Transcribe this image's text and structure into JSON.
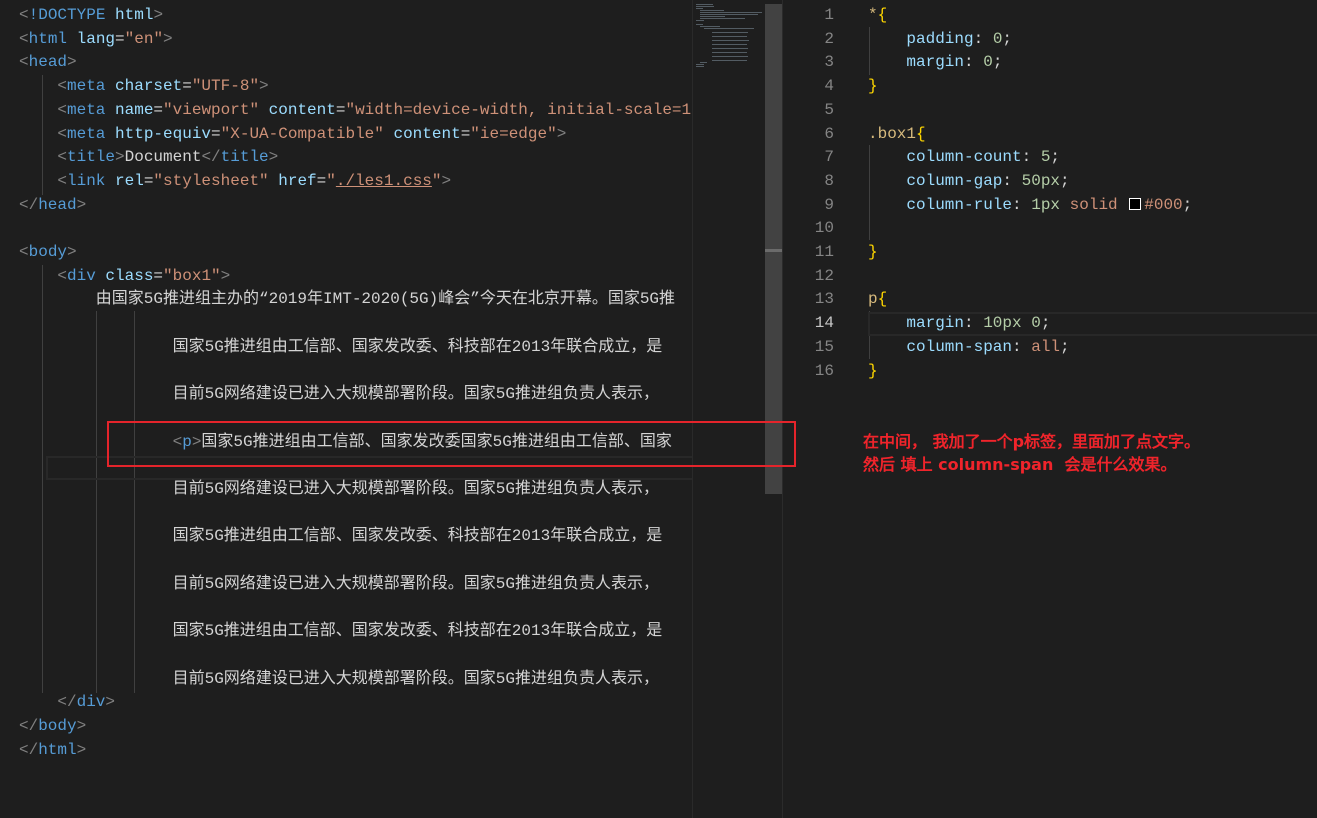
{
  "html_editor": {
    "lines": [
      {
        "indent": 0,
        "tokens": [
          [
            "<",
            "p"
          ],
          [
            "!DOCTYPE",
            "tag"
          ],
          [
            " html",
            "attr"
          ],
          [
            ">",
            "p"
          ]
        ]
      },
      {
        "indent": 0,
        "tokens": [
          [
            "<",
            "p"
          ],
          [
            "html",
            "tag"
          ],
          [
            " lang",
            "attr"
          ],
          [
            "=",
            "txt"
          ],
          [
            "\"en\"",
            "str"
          ],
          [
            ">",
            "p"
          ]
        ]
      },
      {
        "indent": 0,
        "tokens": [
          [
            "<",
            "p"
          ],
          [
            "head",
            "tag"
          ],
          [
            ">",
            "p"
          ]
        ]
      },
      {
        "indent": 4,
        "tokens": [
          [
            "<",
            "p"
          ],
          [
            "meta",
            "tag"
          ],
          [
            " charset",
            "attr"
          ],
          [
            "=",
            "txt"
          ],
          [
            "\"UTF-8\"",
            "str"
          ],
          [
            ">",
            "p"
          ]
        ]
      },
      {
        "indent": 4,
        "tokens": [
          [
            "<",
            "p"
          ],
          [
            "meta",
            "tag"
          ],
          [
            " name",
            "attr"
          ],
          [
            "=",
            "txt"
          ],
          [
            "\"viewport\"",
            "str"
          ],
          [
            " content",
            "attr"
          ],
          [
            "=",
            "txt"
          ],
          [
            "\"width=device-width, initial-scale=1",
            "str"
          ]
        ]
      },
      {
        "indent": 4,
        "tokens": [
          [
            "<",
            "p"
          ],
          [
            "meta",
            "tag"
          ],
          [
            " http-equiv",
            "attr"
          ],
          [
            "=",
            "txt"
          ],
          [
            "\"X-UA-Compatible\"",
            "str"
          ],
          [
            " content",
            "attr"
          ],
          [
            "=",
            "txt"
          ],
          [
            "\"ie=edge\"",
            "str"
          ],
          [
            ">",
            "p"
          ]
        ]
      },
      {
        "indent": 4,
        "tokens": [
          [
            "<",
            "p"
          ],
          [
            "title",
            "tag"
          ],
          [
            ">",
            "p"
          ],
          [
            "Document",
            "txt"
          ],
          [
            "</",
            "p"
          ],
          [
            "title",
            "tag"
          ],
          [
            ">",
            "p"
          ]
        ]
      },
      {
        "indent": 4,
        "tokens": [
          [
            "<",
            "p"
          ],
          [
            "link",
            "tag"
          ],
          [
            " rel",
            "attr"
          ],
          [
            "=",
            "txt"
          ],
          [
            "\"stylesheet\"",
            "str"
          ],
          [
            " href",
            "attr"
          ],
          [
            "=",
            "txt"
          ],
          [
            "\"",
            "str"
          ],
          [
            "./les1.css",
            "link"
          ],
          [
            "\"",
            "str"
          ],
          [
            ">",
            "p"
          ]
        ]
      },
      {
        "indent": 0,
        "tokens": [
          [
            "</",
            "p"
          ],
          [
            "head",
            "tag"
          ],
          [
            ">",
            "p"
          ]
        ]
      },
      {
        "indent": 0,
        "tokens": []
      },
      {
        "indent": 0,
        "tokens": [
          [
            "<",
            "p"
          ],
          [
            "body",
            "tag"
          ],
          [
            ">",
            "p"
          ]
        ]
      },
      {
        "indent": 4,
        "tokens": [
          [
            "<",
            "p"
          ],
          [
            "div",
            "tag"
          ],
          [
            " class",
            "attr"
          ],
          [
            "=",
            "txt"
          ],
          [
            "\"box1\"",
            "str"
          ],
          [
            ">",
            "p"
          ]
        ]
      },
      {
        "indent": 8,
        "tokens": [
          [
            "由国家5G推进组主办的“2019年IMT-2020(5G)峰会”今天在北京开幕。国家5G推",
            "txt"
          ]
        ]
      },
      {
        "indent": 0,
        "tokens": []
      },
      {
        "indent": 16,
        "tokens": [
          [
            "国家5G推进组由工信部、国家发改委、科技部在2013年联合成立，是",
            "txt"
          ]
        ]
      },
      {
        "indent": 0,
        "tokens": []
      },
      {
        "indent": 16,
        "tokens": [
          [
            "目前5G网络建设已进入大规模部署阶段。国家5G推进组负责人表示，",
            "txt"
          ]
        ]
      },
      {
        "indent": 0,
        "tokens": []
      },
      {
        "indent": 16,
        "tokens": [
          [
            "<",
            "p"
          ],
          [
            "p",
            "tag"
          ],
          [
            ">",
            "p"
          ],
          [
            "国家5G推进组由工信部、国家发改委国家5G推进组由工信部、国家",
            "txt"
          ]
        ]
      },
      {
        "indent": 0,
        "tokens": []
      },
      {
        "indent": 16,
        "tokens": [
          [
            "目前5G网络建设已进入大规模部署阶段。国家5G推进组负责人表示，",
            "txt"
          ]
        ]
      },
      {
        "indent": 0,
        "tokens": []
      },
      {
        "indent": 16,
        "tokens": [
          [
            "国家5G推进组由工信部、国家发改委、科技部在2013年联合成立，是",
            "txt"
          ]
        ]
      },
      {
        "indent": 0,
        "tokens": []
      },
      {
        "indent": 16,
        "tokens": [
          [
            "目前5G网络建设已进入大规模部署阶段。国家5G推进组负责人表示，",
            "txt"
          ]
        ]
      },
      {
        "indent": 0,
        "tokens": []
      },
      {
        "indent": 16,
        "tokens": [
          [
            "国家5G推进组由工信部、国家发改委、科技部在2013年联合成立，是",
            "txt"
          ]
        ]
      },
      {
        "indent": 0,
        "tokens": []
      },
      {
        "indent": 16,
        "tokens": [
          [
            "目前5G网络建设已进入大规模部署阶段。国家5G推进组负责人表示，",
            "txt"
          ]
        ]
      },
      {
        "indent": 4,
        "tokens": [
          [
            "</",
            "p"
          ],
          [
            "div",
            "tag"
          ],
          [
            ">",
            "p"
          ]
        ]
      },
      {
        "indent": 0,
        "tokens": [
          [
            "</",
            "p"
          ],
          [
            "body",
            "tag"
          ],
          [
            ">",
            "p"
          ]
        ]
      },
      {
        "indent": 0,
        "tokens": [
          [
            "</",
            "p"
          ],
          [
            "html",
            "tag"
          ],
          [
            ">",
            "p"
          ]
        ]
      }
    ]
  },
  "css_editor": {
    "current_line": 14,
    "lines": [
      {
        "num": "1",
        "indent": 0,
        "tokens": [
          [
            "*",
            "sel"
          ],
          [
            "{",
            "br"
          ]
        ]
      },
      {
        "num": "2",
        "indent": 4,
        "tokens": [
          [
            "padding",
            "prop"
          ],
          [
            ": ",
            "txt"
          ],
          [
            "0",
            "num"
          ],
          [
            ";",
            "txt"
          ]
        ]
      },
      {
        "num": "3",
        "indent": 4,
        "tokens": [
          [
            "margin",
            "prop"
          ],
          [
            ": ",
            "txt"
          ],
          [
            "0",
            "num"
          ],
          [
            ";",
            "txt"
          ]
        ]
      },
      {
        "num": "4",
        "indent": 0,
        "tokens": [
          [
            "}",
            "br"
          ]
        ]
      },
      {
        "num": "5",
        "indent": 0,
        "tokens": []
      },
      {
        "num": "6",
        "indent": 0,
        "tokens": [
          [
            ".box1",
            "sel"
          ],
          [
            "{",
            "br"
          ]
        ]
      },
      {
        "num": "7",
        "indent": 4,
        "tokens": [
          [
            "column-count",
            "prop"
          ],
          [
            ": ",
            "txt"
          ],
          [
            "5",
            "num"
          ],
          [
            ";",
            "txt"
          ]
        ]
      },
      {
        "num": "8",
        "indent": 4,
        "tokens": [
          [
            "column-gap",
            "prop"
          ],
          [
            ": ",
            "txt"
          ],
          [
            "50px",
            "num"
          ],
          [
            ";",
            "txt"
          ]
        ]
      },
      {
        "num": "9",
        "indent": 4,
        "tokens": [
          [
            "column-rule",
            "prop"
          ],
          [
            ": ",
            "txt"
          ],
          [
            "1px",
            "num"
          ],
          [
            " solid ",
            "val"
          ],
          [
            "SWATCH",
            "swatch"
          ],
          [
            "#000",
            "val"
          ],
          [
            ";",
            "txt"
          ]
        ]
      },
      {
        "num": "10",
        "indent": 0,
        "tokens": []
      },
      {
        "num": "11",
        "indent": 0,
        "tokens": [
          [
            "}",
            "br"
          ]
        ]
      },
      {
        "num": "12",
        "indent": 0,
        "tokens": []
      },
      {
        "num": "13",
        "indent": 0,
        "tokens": [
          [
            "p",
            "sel"
          ],
          [
            "{",
            "br"
          ]
        ]
      },
      {
        "num": "14",
        "indent": 4,
        "tokens": [
          [
            "margin",
            "prop"
          ],
          [
            ": ",
            "txt"
          ],
          [
            "10px",
            "num"
          ],
          [
            " ",
            "txt"
          ],
          [
            "0",
            "num"
          ],
          [
            ";",
            "txt"
          ]
        ]
      },
      {
        "num": "15",
        "indent": 4,
        "tokens": [
          [
            "column-span",
            "prop"
          ],
          [
            ": ",
            "txt"
          ],
          [
            "all",
            "val"
          ],
          [
            ";",
            "txt"
          ]
        ]
      },
      {
        "num": "16",
        "indent": 0,
        "tokens": [
          [
            "}",
            "br"
          ]
        ]
      }
    ]
  },
  "annotation": {
    "note": "在中间， 我加了一个p标签，里面加了点文字。\n然后 填上 column-span  会是什么效果。",
    "color": "#f0242b"
  }
}
